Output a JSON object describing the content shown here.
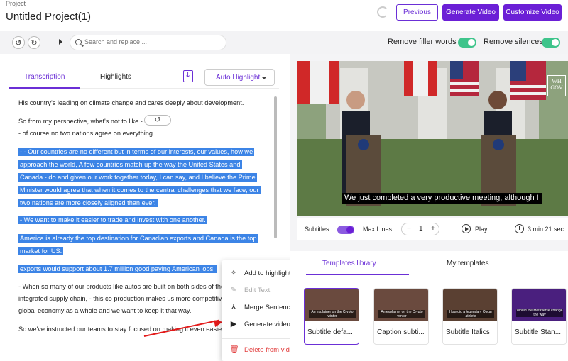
{
  "header": {
    "section_label": "Project",
    "title": "Untitled Project(1)",
    "previous_label": "Previous",
    "generate_label": "Generate Video",
    "customize_label": "Customize Video"
  },
  "toolbar": {
    "search_placeholder": "Search and replace ...",
    "filler_label": "Remove filler words",
    "silences_label": "Remove silences",
    "filler_on": true,
    "silences_on": true
  },
  "left": {
    "tabs": [
      "Transcription",
      "Highlights"
    ],
    "active_tab": "Transcription",
    "auto_highlight_label": "Auto Highlight",
    "lines": [
      {
        "text": "His country's leading on climate change and cares deeply about development.",
        "highlighted": false
      },
      {
        "text": "So from my perspective, what's not to like -",
        "highlighted": false
      },
      {
        "text": "- of course no two nations agree on everything.",
        "highlighted": false
      },
      {
        "text": "- - Our countries are no different but in terms of our interests, our values, how we",
        "highlighted": true
      },
      {
        "text": "approach the world, A few countries match up the way the United States and",
        "highlighted": true
      },
      {
        "text": "Canada - do and given our work together today, I can say, and I believe the Prime",
        "highlighted": true
      },
      {
        "text": "Minister would agree that when it comes to the central challenges that we face, our",
        "highlighted": true
      },
      {
        "text": "two nations are more closely aligned than ever.",
        "highlighted": true
      },
      {
        "text": "- We want to make it easier to trade and invest with one another.",
        "highlighted": true
      },
      {
        "text": "America is already the top destination for Canadian exports and Canada is the top",
        "highlighted": true
      },
      {
        "text": "market for US.",
        "highlighted": true
      },
      {
        "text": "exports would support about 1.7 million good paying American jobs.",
        "highlighted": true
      },
      {
        "text": "- When so many of our products like autos are built on both sides of the",
        "highlighted": false
      },
      {
        "text": "integrated supply chain, - this co production makes us more competitive",
        "highlighted": false
      },
      {
        "text": "global economy as a whole and we want to keep it that way.",
        "highlighted": false
      },
      {
        "text": "So we've instructed our teams to stay focused on making it even easier",
        "highlighted": false
      }
    ]
  },
  "context_menu": {
    "items": [
      {
        "label": "Add to highlights",
        "icon": "magic-wand-icon",
        "state": "normal"
      },
      {
        "label": "Edit Text",
        "icon": "pencil-icon",
        "state": "disabled"
      },
      {
        "label": "Merge Sentences",
        "icon": "merge-icon",
        "state": "normal"
      },
      {
        "label": "Generate video",
        "icon": "video-settings-icon",
        "state": "normal"
      },
      {
        "label": "Delete from video",
        "icon": "trash-icon",
        "state": "danger"
      }
    ]
  },
  "video": {
    "subtitle_text": "We just completed a very productive meeting, although I",
    "logo_text": "WH GOV"
  },
  "controls": {
    "subtitles_label": "Subtitles",
    "subtitles_on": true,
    "max_lines_label": "Max Lines",
    "max_lines_value": "1",
    "minus": "−",
    "plus": "+",
    "play_label": "Play",
    "duration": "3 min 21 sec"
  },
  "templates": {
    "tabs": [
      "Templates library",
      "My templates"
    ],
    "active_tab": "Templates library",
    "cards": [
      {
        "label": "Subtitle defa...",
        "caption": "An explainer on the Crypto winter",
        "selected": true
      },
      {
        "label": "Caption subti...",
        "caption": "An explainer on the Crypto winter",
        "selected": false
      },
      {
        "label": "Subtitle Italics",
        "caption": "How did a legendary Oscar athlete",
        "selected": false
      },
      {
        "label": "Subtitle Stan...",
        "caption": "Would the Metaverse change the way",
        "selected": false
      }
    ]
  },
  "colors": {
    "accent": "#6b1fd6",
    "highlight": "#3c84e6",
    "toggle_green": "#3ec48b",
    "danger": "#e24040",
    "arrow": "#e31b1b"
  }
}
